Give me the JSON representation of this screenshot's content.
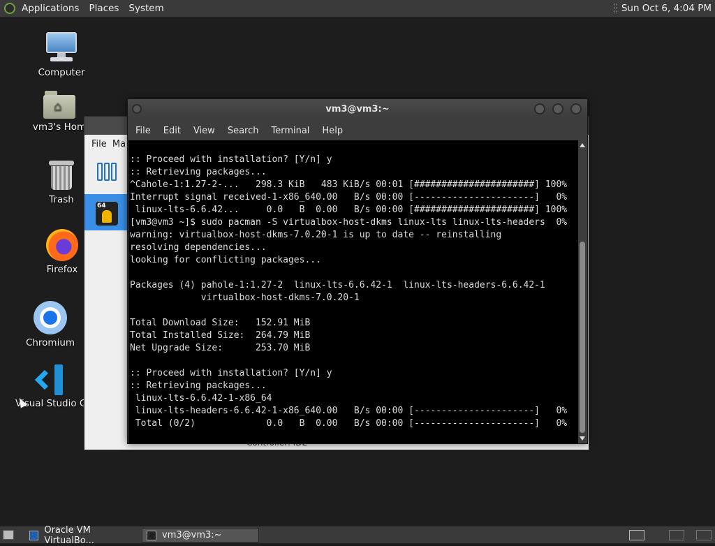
{
  "top_panel": {
    "menus": [
      "Applications",
      "Places",
      "System"
    ],
    "clock": "Sun Oct  6,  4:04 PM"
  },
  "desktop_icons": [
    {
      "label": "Computer",
      "icon": "computer-icon"
    },
    {
      "label": "vm3's Hom",
      "icon": "home-folder-icon"
    },
    {
      "label": "Trash",
      "icon": "trash-icon"
    },
    {
      "label": "Firefox",
      "icon": "firefox-icon"
    },
    {
      "label": "Chromium",
      "icon": "chromium-icon"
    },
    {
      "label": "Visual Studio Coc",
      "icon": "vscode-icon"
    }
  ],
  "vbox_window": {
    "menus": [
      "File",
      "Ma"
    ],
    "status_text": "Controller: IDE",
    "vm_badge": "64",
    "selected_color": "#3a8ee6"
  },
  "terminal": {
    "title": "vm3@vm3:~",
    "menus": [
      "File",
      "Edit",
      "View",
      "Search",
      "Terminal",
      "Help"
    ],
    "lines": [
      ":: Proceed with installation? [Y/n] y",
      ":: Retrieving packages...",
      "^Cahole-1:1.27-2-...   298.3 KiB   483 KiB/s 00:01 [######################] 100%",
      "Interrupt signal received-1-x86_640.00   B/s 00:00 [----------------------]   0%",
      " linux-lts-6.6.42...     0.0   B  0.00   B/s 00:00 [######################] 100%",
      "[vm3@vm3 ~]$ sudo pacman -S virtualbox-host-dkms linux-lts linux-lts-headers  0%",
      "warning: virtualbox-host-dkms-7.0.20-1 is up to date -- reinstalling",
      "resolving dependencies...",
      "looking for conflicting packages...",
      "",
      "Packages (4) pahole-1:1.27-2  linux-lts-6.6.42-1  linux-lts-headers-6.6.42-1",
      "             virtualbox-host-dkms-7.0.20-1",
      "",
      "Total Download Size:   152.91 MiB",
      "Total Installed Size:  264.79 MiB",
      "Net Upgrade Size:      253.70 MiB",
      "",
      ":: Proceed with installation? [Y/n] y",
      ":: Retrieving packages...",
      " linux-lts-6.6.42-1-x86_64",
      " linux-lts-headers-6.6.42-1-x86_640.00   B/s 00:00 [----------------------]   0%",
      " Total (0/2)             0.0   B  0.00   B/s 00:00 [----------------------]   0%"
    ]
  },
  "taskbar": {
    "tasks": [
      "Oracle VM VirtualBo...",
      "vm3@vm3:~"
    ]
  }
}
